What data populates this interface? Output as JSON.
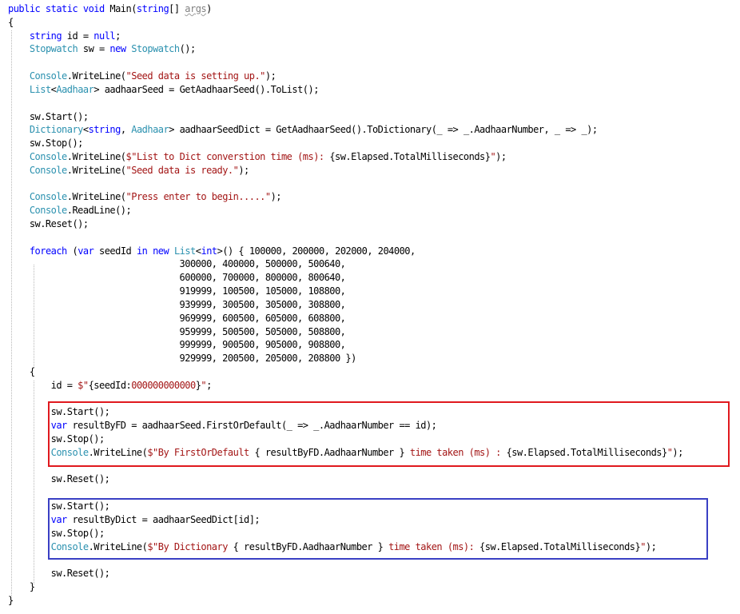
{
  "code": {
    "lines": [
      [
        {
          "t": "public static void ",
          "c": "kw"
        },
        {
          "t": "Main(",
          "c": ""
        },
        {
          "t": "string",
          "c": "kw"
        },
        {
          "t": "[] ",
          "c": ""
        },
        {
          "t": "args",
          "c": "dim squig"
        },
        {
          "t": ")",
          "c": ""
        }
      ],
      [
        {
          "t": "{",
          "c": ""
        }
      ],
      [
        {
          "t": "    ",
          "c": ""
        },
        {
          "t": "string",
          "c": "kw"
        },
        {
          "t": " id = ",
          "c": ""
        },
        {
          "t": "null",
          "c": "kw"
        },
        {
          "t": ";",
          "c": ""
        }
      ],
      [
        {
          "t": "    ",
          "c": ""
        },
        {
          "t": "Stopwatch",
          "c": "ty"
        },
        {
          "t": " sw = ",
          "c": ""
        },
        {
          "t": "new",
          "c": "kw"
        },
        {
          "t": " ",
          "c": ""
        },
        {
          "t": "Stopwatch",
          "c": "ty"
        },
        {
          "t": "();",
          "c": ""
        }
      ],
      [],
      [
        {
          "t": "    ",
          "c": ""
        },
        {
          "t": "Console",
          "c": "ty"
        },
        {
          "t": ".WriteLine(",
          "c": ""
        },
        {
          "t": "\"Seed data is setting up.\"",
          "c": "st"
        },
        {
          "t": ");",
          "c": ""
        }
      ],
      [
        {
          "t": "    ",
          "c": ""
        },
        {
          "t": "List",
          "c": "ty"
        },
        {
          "t": "<",
          "c": ""
        },
        {
          "t": "Aadhaar",
          "c": "ty"
        },
        {
          "t": "> aadhaarSeed = GetAadhaarSeed().ToList();",
          "c": ""
        }
      ],
      [],
      [
        {
          "t": "    sw.Start();",
          "c": ""
        }
      ],
      [
        {
          "t": "    ",
          "c": ""
        },
        {
          "t": "Dictionary",
          "c": "ty"
        },
        {
          "t": "<",
          "c": ""
        },
        {
          "t": "string",
          "c": "kw"
        },
        {
          "t": ", ",
          "c": ""
        },
        {
          "t": "Aadhaar",
          "c": "ty"
        },
        {
          "t": "> aadhaarSeedDict = GetAadhaarSeed().ToDictionary(_ => _.AadhaarNumber, _ => _);",
          "c": ""
        }
      ],
      [
        {
          "t": "    sw.Stop();",
          "c": ""
        }
      ],
      [
        {
          "t": "    ",
          "c": ""
        },
        {
          "t": "Console",
          "c": "ty"
        },
        {
          "t": ".WriteLine(",
          "c": ""
        },
        {
          "t": "$\"List to Dict converstion time (ms): ",
          "c": "st"
        },
        {
          "t": "{sw.Elapsed.TotalMilliseconds}",
          "c": ""
        },
        {
          "t": "\"",
          "c": "st"
        },
        {
          "t": ");",
          "c": ""
        }
      ],
      [
        {
          "t": "    ",
          "c": ""
        },
        {
          "t": "Console",
          "c": "ty"
        },
        {
          "t": ".WriteLine(",
          "c": ""
        },
        {
          "t": "\"Seed data is ready.\"",
          "c": "st"
        },
        {
          "t": ");",
          "c": ""
        }
      ],
      [],
      [
        {
          "t": "    ",
          "c": ""
        },
        {
          "t": "Console",
          "c": "ty"
        },
        {
          "t": ".WriteLine(",
          "c": ""
        },
        {
          "t": "\"Press enter to begin.....\"",
          "c": "st"
        },
        {
          "t": ");",
          "c": ""
        }
      ],
      [
        {
          "t": "    ",
          "c": ""
        },
        {
          "t": "Console",
          "c": "ty"
        },
        {
          "t": ".ReadLine();",
          "c": ""
        }
      ],
      [
        {
          "t": "    sw.Reset();",
          "c": ""
        }
      ],
      [],
      [
        {
          "t": "    ",
          "c": ""
        },
        {
          "t": "foreach",
          "c": "kw"
        },
        {
          "t": " (",
          "c": ""
        },
        {
          "t": "var",
          "c": "kw"
        },
        {
          "t": " seedId ",
          "c": ""
        },
        {
          "t": "in",
          "c": "kw"
        },
        {
          "t": " ",
          "c": ""
        },
        {
          "t": "new",
          "c": "kw"
        },
        {
          "t": " ",
          "c": ""
        },
        {
          "t": "List",
          "c": "ty"
        },
        {
          "t": "<",
          "c": ""
        },
        {
          "t": "int",
          "c": "kw"
        },
        {
          "t": ">() { 100000, 200000, 202000, 204000,",
          "c": ""
        }
      ],
      [
        {
          "t": "                                300000, 400000, 500000, 500640,",
          "c": ""
        }
      ],
      [
        {
          "t": "                                600000, 700000, 800000, 800640,",
          "c": ""
        }
      ],
      [
        {
          "t": "                                919999, 100500, 105000, 108800,",
          "c": ""
        }
      ],
      [
        {
          "t": "                                939999, 300500, 305000, 308800,",
          "c": ""
        }
      ],
      [
        {
          "t": "                                969999, 600500, 605000, 608800,",
          "c": ""
        }
      ],
      [
        {
          "t": "                                959999, 500500, 505000, 508800,",
          "c": ""
        }
      ],
      [
        {
          "t": "                                999999, 900500, 905000, 908800,",
          "c": ""
        }
      ],
      [
        {
          "t": "                                929999, 200500, 205000, 208800 })",
          "c": ""
        }
      ],
      [
        {
          "t": "    {",
          "c": ""
        }
      ],
      [
        {
          "t": "        id = ",
          "c": ""
        },
        {
          "t": "$\"",
          "c": "st"
        },
        {
          "t": "{seedId:",
          "c": ""
        },
        {
          "t": "000000000000",
          "c": "st"
        },
        {
          "t": "}",
          "c": ""
        },
        {
          "t": "\"",
          "c": "st"
        },
        {
          "t": ";",
          "c": ""
        }
      ],
      [],
      [
        {
          "t": "        sw.Start();",
          "c": ""
        }
      ],
      [
        {
          "t": "        ",
          "c": ""
        },
        {
          "t": "var",
          "c": "kw"
        },
        {
          "t": " resultByFD = aadhaarSeed.FirstOrDefault(_ => _.AadhaarNumber == id);",
          "c": ""
        }
      ],
      [
        {
          "t": "        sw.Stop();",
          "c": ""
        }
      ],
      [
        {
          "t": "        ",
          "c": ""
        },
        {
          "t": "Console",
          "c": "ty"
        },
        {
          "t": ".WriteLine(",
          "c": ""
        },
        {
          "t": "$\"By FirstOrDefault ",
          "c": "st"
        },
        {
          "t": "{ resultByFD.AadhaarNumber }",
          "c": ""
        },
        {
          "t": " time taken (ms) : ",
          "c": "st"
        },
        {
          "t": "{sw.Elapsed.TotalMilliseconds}",
          "c": ""
        },
        {
          "t": "\"",
          "c": "st"
        },
        {
          "t": ");",
          "c": ""
        }
      ],
      [],
      [
        {
          "t": "        sw.Reset();",
          "c": ""
        }
      ],
      [],
      [
        {
          "t": "        sw.Start();",
          "c": ""
        }
      ],
      [
        {
          "t": "        ",
          "c": ""
        },
        {
          "t": "var",
          "c": "kw"
        },
        {
          "t": " resultByDict = aadhaarSeedDict[id];",
          "c": ""
        }
      ],
      [
        {
          "t": "        sw.Stop();",
          "c": ""
        }
      ],
      [
        {
          "t": "        ",
          "c": ""
        },
        {
          "t": "Console",
          "c": "ty"
        },
        {
          "t": ".WriteLine(",
          "c": ""
        },
        {
          "t": "$\"By Dictionary ",
          "c": "st"
        },
        {
          "t": "{ resultByFD.AadhaarNumber }",
          "c": ""
        },
        {
          "t": " time taken (ms): ",
          "c": "st"
        },
        {
          "t": "{sw.Elapsed.TotalMilliseconds}",
          "c": ""
        },
        {
          "t": "\"",
          "c": "st"
        },
        {
          "t": ");",
          "c": ""
        }
      ],
      [],
      [
        {
          "t": "        sw.Reset();",
          "c": ""
        }
      ],
      [
        {
          "t": "    }",
          "c": ""
        }
      ],
      [
        {
          "t": "}",
          "c": ""
        }
      ]
    ]
  },
  "highlights": {
    "first_or_default_color": "#e0191e",
    "dictionary_color": "#3a40c4"
  }
}
